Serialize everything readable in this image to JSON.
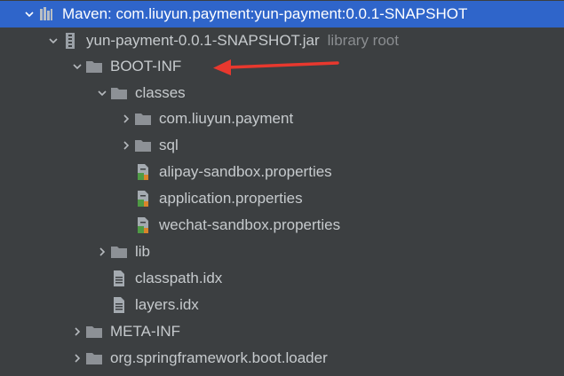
{
  "tree": {
    "maven_node": {
      "label": "Maven: com.liuyun.payment:yun-payment:0.0.1-SNAPSHOT"
    },
    "jar_node": {
      "label": "yun-payment-0.0.1-SNAPSHOT.jar",
      "hint": "library root"
    },
    "boot_inf": {
      "label": "BOOT-INF"
    },
    "classes": {
      "label": "classes"
    },
    "com_liuyun_payment": {
      "label": "com.liuyun.payment"
    },
    "sql": {
      "label": "sql"
    },
    "alipay_props": {
      "label": "alipay-sandbox.properties"
    },
    "application_props": {
      "label": "application.properties"
    },
    "wechat_props": {
      "label": "wechat-sandbox.properties"
    },
    "lib": {
      "label": "lib"
    },
    "classpath_idx": {
      "label": "classpath.idx"
    },
    "layers_idx": {
      "label": "layers.idx"
    },
    "meta_inf": {
      "label": "META-INF"
    },
    "spring_loader": {
      "label": "org.springframework.boot.loader"
    }
  },
  "colors": {
    "background": "#3c3f41",
    "selection": "#2f65ca",
    "text": "#c6cacd",
    "hint_text": "#8a8d90",
    "folder": "#8d9196",
    "annotation_arrow": "#e8382e"
  },
  "icons": {
    "maven": "maven-library-icon",
    "jar": "jar-archive-icon",
    "folder": "folder-icon",
    "properties": "properties-file-icon",
    "text_file": "text-file-icon"
  }
}
